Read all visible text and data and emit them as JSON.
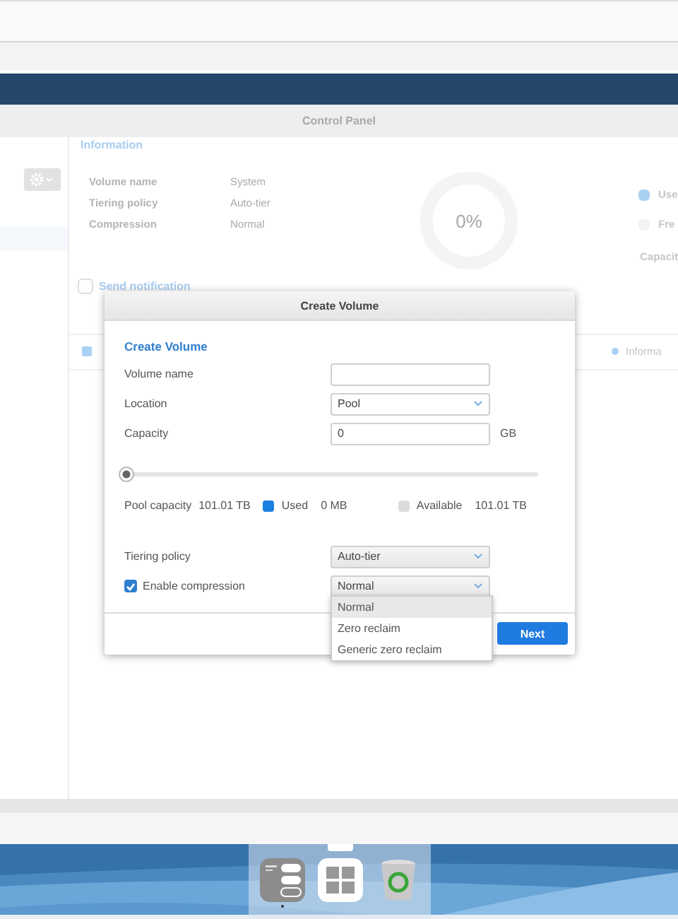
{
  "window": {
    "title": "Control Panel"
  },
  "info": {
    "heading": "Information",
    "rows": [
      {
        "label": "Volume name",
        "value": "System"
      },
      {
        "label": "Tiering policy",
        "value": "Auto-tier"
      },
      {
        "label": "Compression",
        "value": "Normal"
      }
    ],
    "usage": "0%",
    "legend": [
      {
        "label": "Use",
        "color": "#a9d1f4"
      },
      {
        "label": "Fre",
        "color": "#f3f3f3"
      }
    ],
    "capacity_label": "Capacit",
    "notification": {
      "label": "Send notification",
      "checked": false
    },
    "status": "Informa"
  },
  "dialog": {
    "title": "Create Volume",
    "heading": "Create Volume",
    "fields": [
      {
        "kind": "text",
        "label": "Volume name"
      },
      {
        "kind": "select",
        "label": "Location",
        "value": "Pool"
      },
      {
        "kind": "text",
        "label": "Capacity",
        "value": "0",
        "unit": "GB"
      }
    ],
    "slider": {
      "level": 0
    },
    "pool": {
      "label": "Pool capacity",
      "total": "101.01 TB",
      "legend": [
        {
          "label": "Used",
          "value": "0 MB",
          "color": "#1a7fe0"
        },
        {
          "label": "Available",
          "value": "101.01 TB",
          "color": "#dcdcdc"
        }
      ]
    },
    "settings": [
      {
        "kind": "select",
        "label": "Tiering policy",
        "value": "Auto-tier"
      },
      {
        "kind": "checkbox-select",
        "label": "Enable compression",
        "checked": true,
        "value": "Normal"
      }
    ],
    "options": [
      {
        "label": "Normal",
        "selected": true
      },
      {
        "label": "Zero reclaim",
        "selected": false
      },
      {
        "label": "Generic zero reclaim",
        "selected": false
      }
    ],
    "buttons": [
      {
        "label": "Next",
        "kind": "primary"
      }
    ]
  },
  "dock": [
    {
      "kind": "control-panel",
      "running": true
    },
    {
      "kind": "apps",
      "running": false
    },
    {
      "kind": "trash",
      "running": false
    }
  ]
}
